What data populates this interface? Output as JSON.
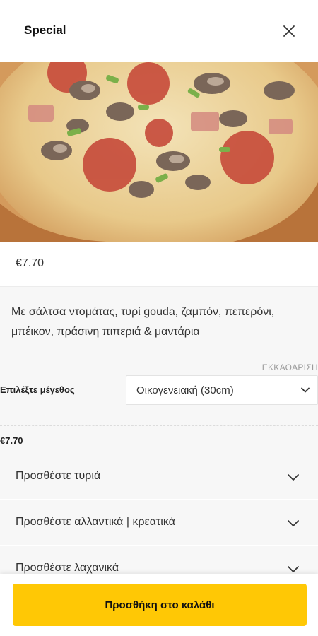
{
  "header": {
    "title": "Special",
    "close_icon": "close-icon"
  },
  "product": {
    "image_alt": "pizza with mushrooms, pepperoni, ham and green peppers",
    "price": "€7.70",
    "description": "Με σάλτσα ντομάτας, τυρί gouda, ζαμπόν, πεπερόνι, μπέικον, πράσινη πιπεριά & μαντάρια"
  },
  "options": {
    "clear_label": "ΕΚΚΑΘΑΡΙΣΗ",
    "size_label": "Επιλέξτε μέγεθος",
    "size_selected": "Οικογενειακή (30cm)",
    "total_price": "€7.70"
  },
  "accordions": [
    {
      "label": "Προσθέστε τυριά"
    },
    {
      "label": "Προσθέστε αλλαντικά | κρεατικά"
    },
    {
      "label": "Προσθέστε λαχανικά"
    }
  ],
  "cta": {
    "label": "Προσθήκη στο καλάθι",
    "color": "#ffc805"
  }
}
